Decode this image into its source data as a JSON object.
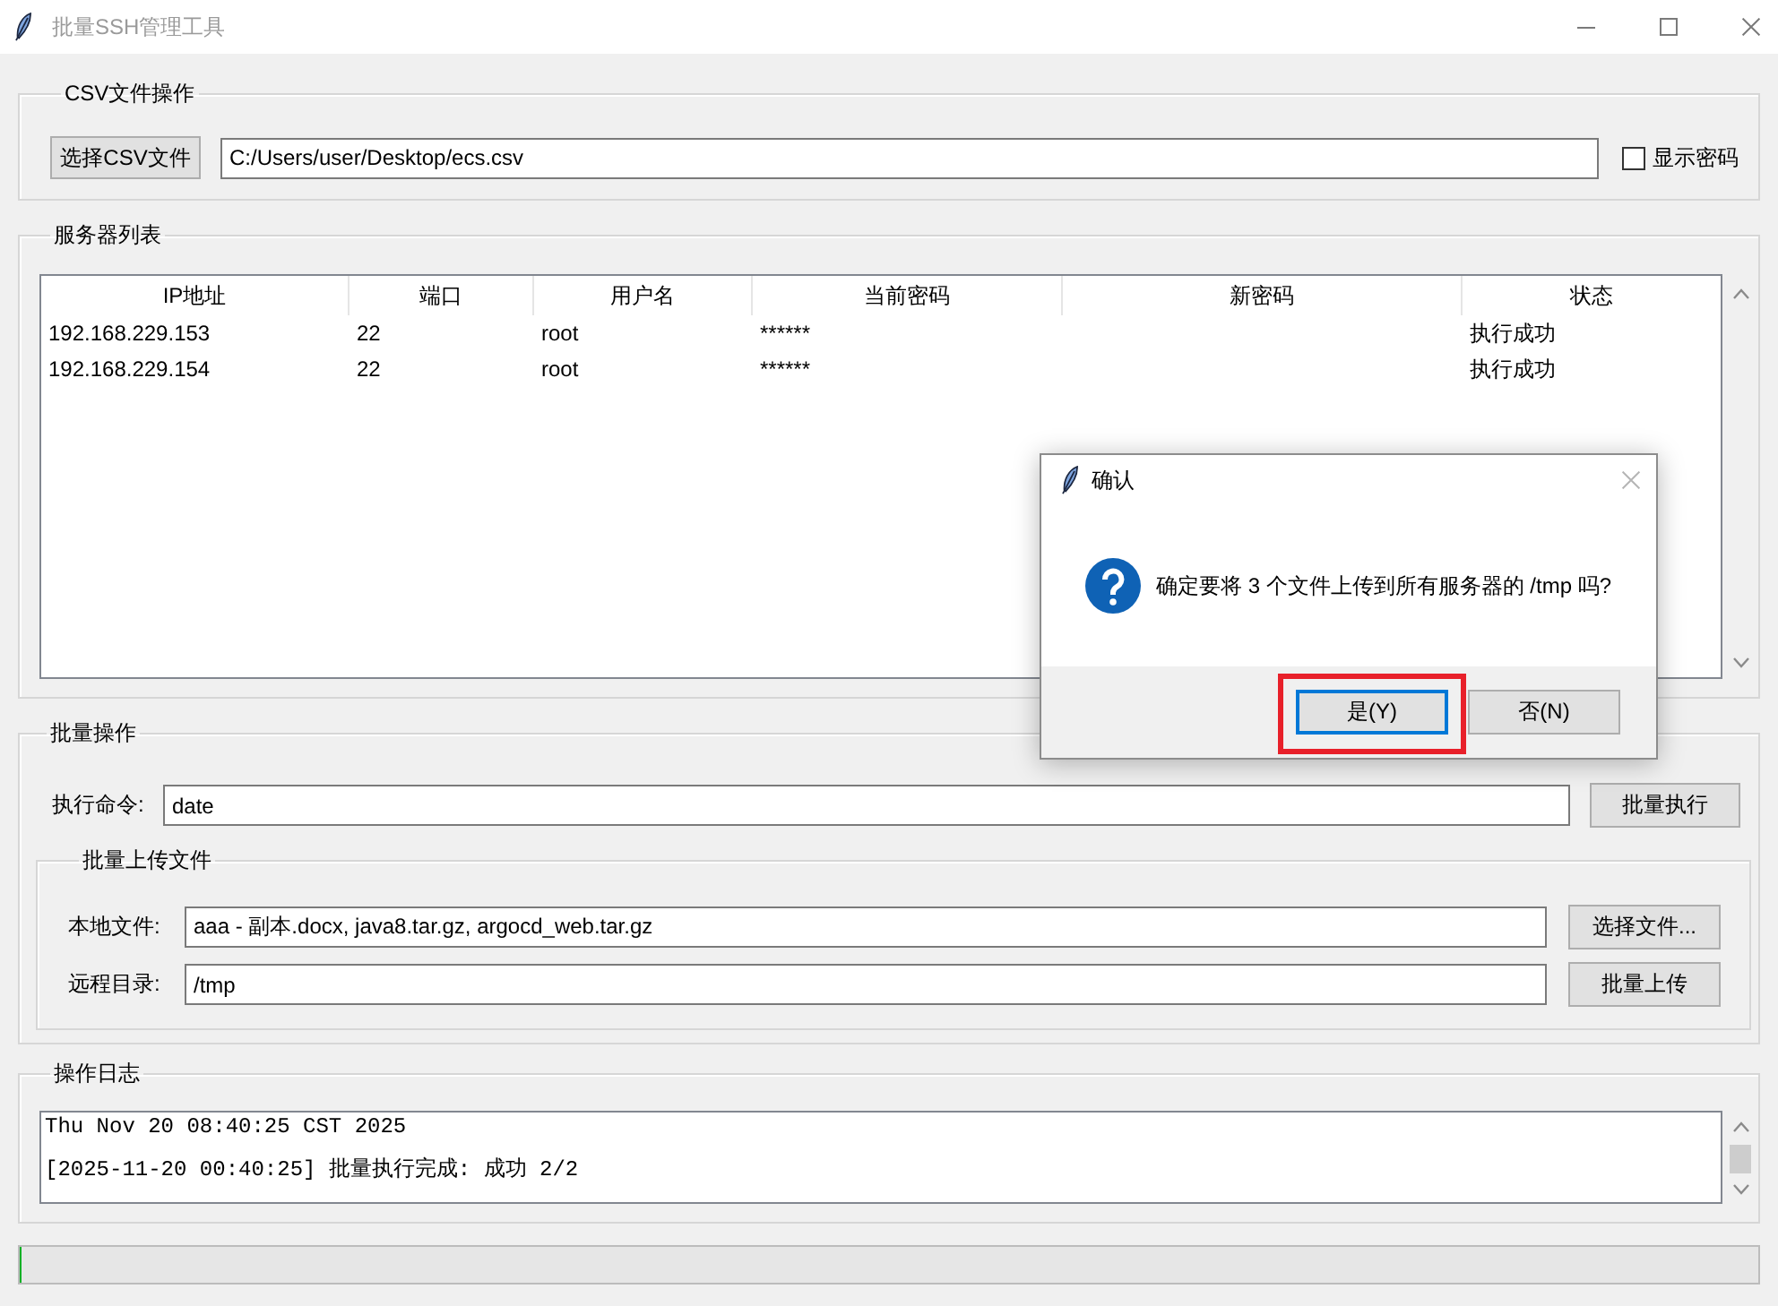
{
  "window": {
    "title": "批量SSH管理工具"
  },
  "csv_section": {
    "title": "CSV文件操作",
    "select_button": "选择CSV文件",
    "file_path": "C:/Users/user/Desktop/ecs.csv",
    "show_password": {
      "label": "显示密码",
      "checked": false
    }
  },
  "server_list": {
    "title": "服务器列表",
    "columns": [
      "IP地址",
      "端口",
      "用户名",
      "当前密码",
      "新密码",
      "状态"
    ],
    "rows": [
      {
        "ip": "192.168.229.153",
        "port": "22",
        "username": "root",
        "current_password": "******",
        "status": "执行成功"
      },
      {
        "ip": "192.168.229.154",
        "port": "22",
        "username": "root",
        "current_password": "******",
        "status": "执行成功"
      }
    ]
  },
  "batch_ops": {
    "title": "批量操作",
    "command": {
      "label": "执行命令:",
      "value": "date",
      "button": "批量执行"
    },
    "upload": {
      "title": "批量上传文件",
      "local_files": {
        "label": "本地文件:",
        "value": "aaa - 副本.docx, java8.tar.gz, argocd_web.tar.gz",
        "button": "选择文件..."
      },
      "remote_dir": {
        "label": "远程目录:",
        "value": "/tmp",
        "button": "批量上传"
      }
    }
  },
  "log": {
    "title": "操作日志",
    "lines": [
      "Thu Nov 20 08:40:25 CST 2025",
      "[2025-11-20 00:40:25] 批量执行完成: 成功 2/2"
    ]
  },
  "progress": {
    "level": 0
  },
  "dialog": {
    "title": "确认",
    "message": "确定要将 3 个文件上传到所有服务器的 /tmp 吗?",
    "buttons": [
      {
        "label": "是(Y)",
        "focused": true,
        "highlighted": true
      },
      {
        "label": "否(N)",
        "focused": false,
        "highlighted": false
      }
    ]
  }
}
